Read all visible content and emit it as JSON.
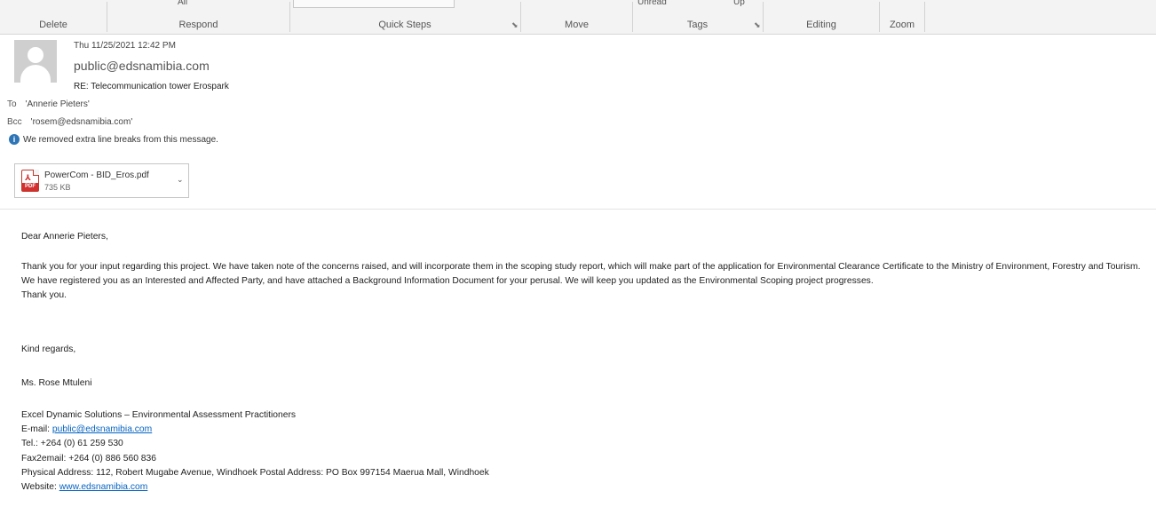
{
  "ribbon": {
    "top_fragments": [
      "All",
      "Unread",
      "Up"
    ],
    "groups": [
      "Delete",
      "Respond",
      "Quick Steps",
      "Move",
      "Tags",
      "Editing",
      "Zoom"
    ]
  },
  "header": {
    "datetime": "Thu 11/25/2021 12:42 PM",
    "sender": "public@edsnamibia.com",
    "subject": "RE: Telecommunication tower Erospark",
    "to_label": "To",
    "to_value": "'Annerie Pieters'",
    "bcc_label": "Bcc",
    "bcc_value": "'rosem@edsnamibia.com'",
    "info_text": "We removed extra line breaks from this message."
  },
  "attachment": {
    "icon": "pdf-file-icon",
    "icon_badge": "PDF",
    "name": "PowerCom - BID_Eros.pdf",
    "size": "735 KB"
  },
  "body": {
    "greeting": "Dear Annerie Pieters,",
    "para1": "Thank you for your input regarding this project. We have taken note of the concerns raised, and will incorporate them in the scoping study report, which will make part of the application for Environmental Clearance Certificate to the Ministry of Environment, Forestry and Tourism.",
    "para2": "We have registered you as an Interested and Affected Party, and have attached a Background Information Document for your perusal. We will keep you updated as the Environmental Scoping project progresses.",
    "para3": "Thank you.",
    "closing": "Kind regards,",
    "signer": "Ms. Rose Mtuleni"
  },
  "signature": {
    "company": "Excel Dynamic Solutions – Environmental Assessment Practitioners",
    "email_label": "E-mail: ",
    "email": "public@edsnamibia.com",
    "tel": "Tel.: +264 (0) 61 259 530",
    "fax": "Fax2email: +264 (0) 886 560 836",
    "address": "Physical Address: 112, Robert Mugabe Avenue, Windhoek Postal Address: PO Box 997154 Maerua Mall, Windhoek",
    "website_label": "Website: ",
    "website": "www.edsnamibia.com"
  },
  "colors": {
    "link": "#0563c1",
    "info": "#2e75b6",
    "pdf": "#d32f2f"
  }
}
